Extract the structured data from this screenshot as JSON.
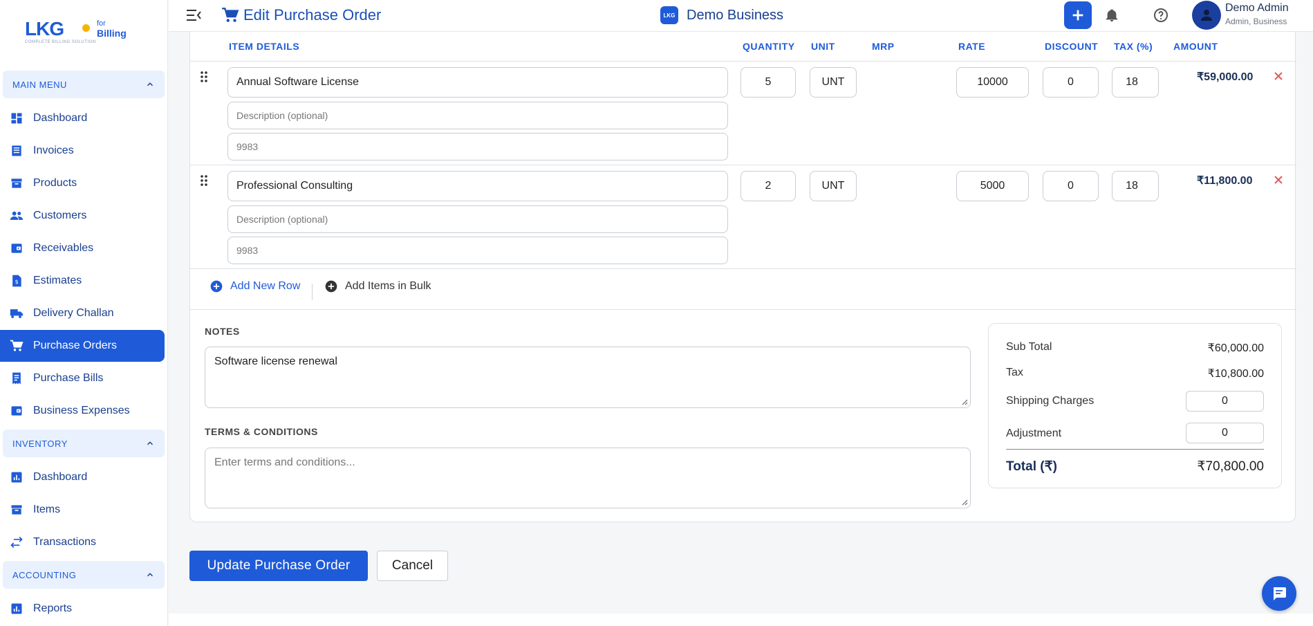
{
  "brand": {
    "mark": "LKG",
    "for": "for",
    "product": "Billing",
    "tagline": "COMPLETE BILLING SOLUTION"
  },
  "header": {
    "title": "Edit Purchase Order",
    "business": "Demo Business",
    "business_badge": "LKG",
    "user_name": "Demo Admin",
    "user_role": "Admin, Business"
  },
  "sidebar": {
    "main_menu": "MAIN MENU",
    "main_items": [
      {
        "label": "Dashboard"
      },
      {
        "label": "Invoices"
      },
      {
        "label": "Products"
      },
      {
        "label": "Customers"
      },
      {
        "label": "Receivables"
      },
      {
        "label": "Estimates"
      },
      {
        "label": "Delivery Challan"
      },
      {
        "label": "Purchase Orders"
      },
      {
        "label": "Purchase Bills"
      },
      {
        "label": "Business Expenses"
      }
    ],
    "inventory": "INVENTORY",
    "inventory_items": [
      {
        "label": "Dashboard"
      },
      {
        "label": "Items"
      },
      {
        "label": "Transactions"
      }
    ],
    "accounting": "ACCOUNTING",
    "accounting_items": [
      {
        "label": "Reports"
      }
    ]
  },
  "table": {
    "headers": {
      "item": "ITEM DETAILS",
      "quantity": "QUANTITY",
      "unit": "UNIT",
      "mrp": "MRP",
      "rate": "RATE",
      "discount": "DISCOUNT",
      "tax": "TAX (%)",
      "amount": "AMOUNT"
    },
    "rows": [
      {
        "name": "Annual Software License",
        "description_placeholder": "Description (optional)",
        "code": "9983",
        "quantity": "5",
        "unit": "UNT",
        "rate": "10000",
        "discount": "0",
        "tax": "18",
        "amount": "₹59,000.00"
      },
      {
        "name": "Professional Consulting",
        "description_placeholder": "Description (optional)",
        "code": "9983",
        "quantity": "2",
        "unit": "UNT",
        "rate": "5000",
        "discount": "0",
        "tax": "18",
        "amount": "₹11,800.00"
      }
    ],
    "add_row": "Add New Row",
    "add_bulk": "Add Items in Bulk"
  },
  "notes": {
    "label": "NOTES",
    "value": "Software license renewal"
  },
  "terms": {
    "label": "TERMS & CONDITIONS",
    "placeholder": "Enter terms and conditions..."
  },
  "totals": {
    "subtotal_label": "Sub Total",
    "subtotal": "₹60,000.00",
    "tax_label": "Tax",
    "tax": "₹10,800.00",
    "shipping_label": "Shipping Charges",
    "shipping": "0",
    "adjustment_label": "Adjustment",
    "adjustment": "0",
    "total_label": "Total (₹)",
    "total": "₹70,800.00"
  },
  "actions": {
    "update": "Update Purchase Order",
    "cancel": "Cancel"
  },
  "colors": {
    "accent": "#1f5bd8",
    "delete": "#e05a5a"
  }
}
